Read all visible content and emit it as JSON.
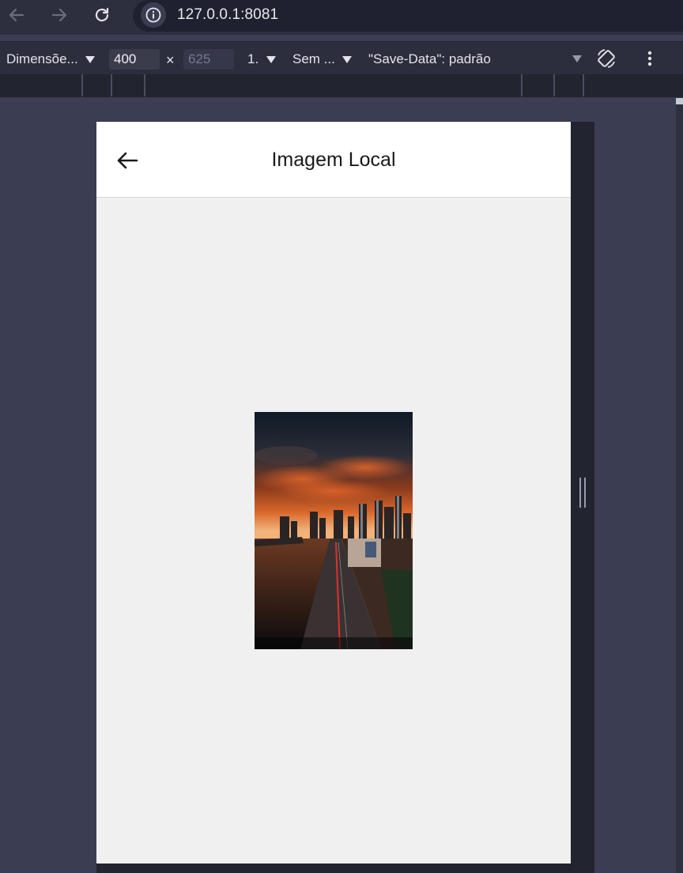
{
  "browser": {
    "url": "127.0.0.1:8081",
    "icons": {
      "back": "arrow-left-icon",
      "forward": "arrow-right-icon",
      "reload": "reload-icon",
      "info": "info-icon"
    }
  },
  "device_toolbar": {
    "dimensions_label": "Dimensõe...",
    "width_value": "400",
    "times": "×",
    "height_value": "625",
    "zoom_label": "1.",
    "throttle_label": "Sem ...",
    "save_data_label": "\"Save-Data\": padrão",
    "icons": {
      "rotate": "rotate-icon",
      "more": "kebab-menu-icon"
    }
  },
  "app": {
    "title": "Imagem Local",
    "back_icon": "arrow-left-icon",
    "image_description": "city skyline at sunset"
  },
  "colors": {
    "browser_bg": "#3b3d52",
    "toolbar_bg": "#2c2e3d",
    "app_bg": "#f0f0f0",
    "header_bg": "#ffffff"
  }
}
